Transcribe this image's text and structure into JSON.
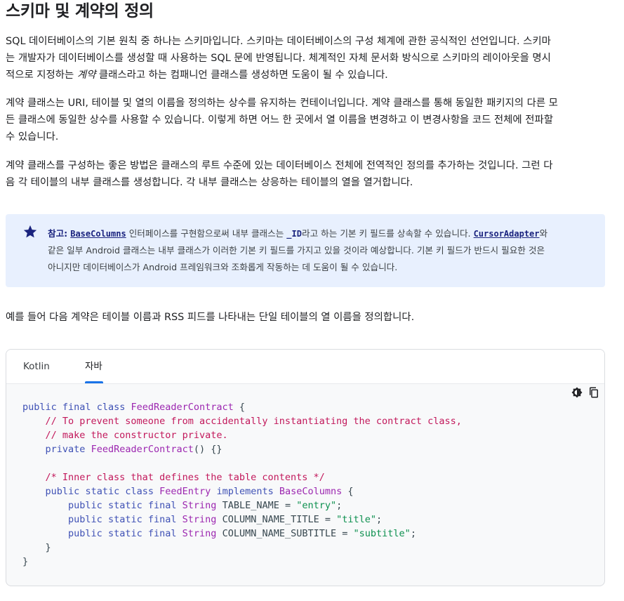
{
  "title": "스키마 및 계약의 정의",
  "para1": {
    "lines": [
      "SQL 데이터베이스의 기본 원칙 중 하나는 스키마입니다. 스키마는 데이터베이스의 구성 체계에 관한 공식적인 선언입니다. 스키마",
      "는 개발자가 데이터베이스를 생성할 때 사용하는 SQL 문에 반영됩니다. 체계적인 자체 문서화 방식으로 스키마의 레이아웃을 명시"
    ],
    "line3_pre": "적으로 지정하는 ",
    "line3_em": "계약",
    "line3_post": " 클래스라고 하는 컴패니언 클래스를 생성하면 도움이 될 수 있습니다."
  },
  "para2": {
    "lines": [
      "계약 클래스는 URI, 테이블 및 열의 이름을 정의하는 상수를 유지하는 컨테이너입니다. 계약 클래스를 통해 동일한 패키지의 다른 모",
      "든 클래스에 동일한 상수를 사용할 수 있습니다. 이렇게 하면 어느 한 곳에서 열 이름을 변경하고 이 변경사항을 코드 전체에 전파할",
      "수 있습니다."
    ]
  },
  "para3": {
    "lines": [
      "계약 클래스를 구성하는 좋은 방법은 클래스의 루트 수준에 있는 데이터베이스 전체에 전역적인 정의를 추가하는 것입니다. 그런 다",
      "음 각 테이블의 내부 클래스를 생성합니다. 각 내부 클래스는 상응하는 테이블의 열을 열거합니다."
    ]
  },
  "note": {
    "icon": "star-icon",
    "label": "참고:",
    "link1": "BaseColumns",
    "text1": " 인터페이스를 구현함으로써 내부 클래스는 ",
    "code_id": "_ID",
    "text2": "라고 하는 기본 키 필드를 상속할 수 있습니다. ",
    "link2": "CursorAdapter",
    "text3": "와",
    "line2": "같은 일부 Android 클래스는 내부 클래스가 이러한 기본 키 필드를 가지고 있을 것이라 예상합니다. 기본 키 필드가 반드시 필요한 것은",
    "line3": "아니지만 데이터베이스가 Android 프레임워크와 조화롭게 작동하는 데 도움이 될 수 있습니다.",
    "accent": "#e8f0fe"
  },
  "para4": "예를 들어 다음 계약은 테이블 이름과 RSS 피드를 나타내는 단일 테이블의 열 이름을 정의합니다.",
  "code_box": {
    "tabs": [
      {
        "label": "Kotlin",
        "active": false
      },
      {
        "label": "자바",
        "active": true
      }
    ],
    "tools": [
      "theme-toggle-icon",
      "copy-icon"
    ],
    "code": {
      "l1": {
        "kw1": "public",
        "kw2": "final",
        "kw3": "class",
        "name": "FeedReaderContract",
        "rest": " {"
      },
      "l2": "    // To prevent someone from accidentally instantiating the contract class,",
      "l3": "    // make the constructor private.",
      "l4": {
        "kw": "private",
        "name": "FeedReaderContract",
        "rest": "() {}"
      },
      "l6": "    /* Inner class that defines the table contents */",
      "l7": {
        "kw1": "public",
        "kw2": "static",
        "kw3": "class",
        "name": "FeedEntry",
        "kw4": "implements",
        "iface": "BaseColumns",
        "rest": " {"
      },
      "fields": [
        {
          "name": "TABLE_NAME",
          "value": "\"entry\""
        },
        {
          "name": "COLUMN_NAME_TITLE",
          "value": "\"title\""
        },
        {
          "name": "COLUMN_NAME_SUBTITLE",
          "value": "\"subtitle\""
        }
      ],
      "field_kw": [
        "public",
        "static",
        "final"
      ],
      "field_type": "String",
      "close_inner": "    }",
      "close_outer": "}"
    }
  }
}
